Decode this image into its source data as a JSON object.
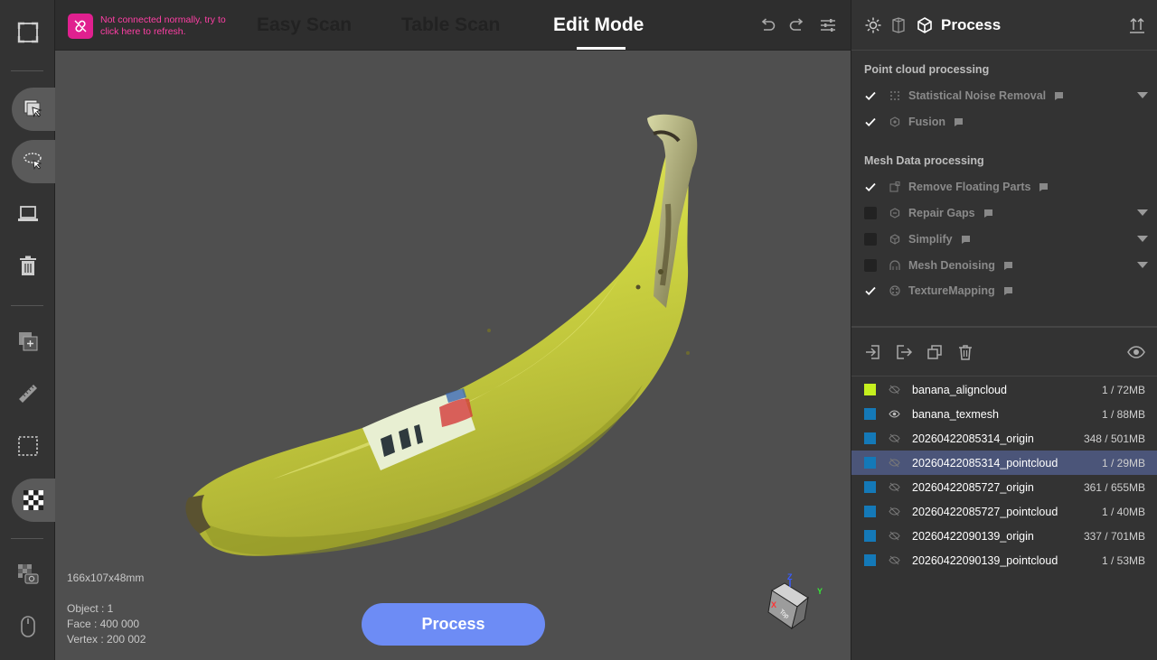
{
  "connection": {
    "message": "Not connected normally, try to click here to refresh.",
    "color": "#e0208f"
  },
  "modes": {
    "easy_scan": "Easy Scan",
    "table_scan": "Table Scan",
    "edit_mode": "Edit Mode",
    "active": "edit_mode"
  },
  "viewport": {
    "dimensions": "166x107x48mm",
    "object": "Object : 1",
    "face": "Face : 400 000",
    "vertex": "Vertex : 200 002",
    "process_button": "Process",
    "axes": {
      "z": "Z",
      "y": "Y",
      "x": "X",
      "top": "Top"
    }
  },
  "left_toolbar": {
    "items": [
      {
        "icon": "fit-view-icon"
      },
      {
        "icon": "select-cursor-icon",
        "active": true
      },
      {
        "icon": "lasso-select-icon",
        "active": true
      },
      {
        "icon": "laptop-icon"
      },
      {
        "icon": "trash-icon"
      },
      {
        "icon": "add-copy-icon"
      },
      {
        "icon": "ruler-icon"
      },
      {
        "icon": "crop-frame-icon"
      },
      {
        "icon": "checkerboard-icon",
        "active": true
      },
      {
        "icon": "texture-camera-icon"
      },
      {
        "icon": "mouse-icon"
      }
    ]
  },
  "process_panel": {
    "title": "Process",
    "sections": [
      {
        "title": "Point cloud processing",
        "items": [
          {
            "label": "Statistical Noise Removal",
            "checked": true,
            "dropdown": true
          },
          {
            "label": "Fusion",
            "checked": true,
            "dropdown": false
          }
        ]
      },
      {
        "title": "Mesh Data processing",
        "items": [
          {
            "label": "Remove Floating Parts",
            "checked": true,
            "dropdown": false
          },
          {
            "label": "Repair Gaps",
            "checked": false,
            "dropdown": true
          },
          {
            "label": "Simplify",
            "checked": false,
            "dropdown": true
          },
          {
            "label": "Mesh Denoising",
            "checked": false,
            "dropdown": true
          },
          {
            "label": "TextureMapping",
            "checked": true,
            "dropdown": false
          }
        ]
      }
    ]
  },
  "files": [
    {
      "name": "banana_aligncloud",
      "size": "1 / 72MB",
      "color": "#c6f01e",
      "visible": false,
      "selected": false
    },
    {
      "name": "banana_texmesh",
      "size": "1 / 88MB",
      "color": "#1479b8",
      "visible": true,
      "selected": false
    },
    {
      "name": "20260422085314_origin",
      "size": "348 / 501MB",
      "color": "#1479b8",
      "visible": false,
      "selected": false
    },
    {
      "name": "20260422085314_pointcloud",
      "size": "1 / 29MB",
      "color": "#1479b8",
      "visible": false,
      "selected": true
    },
    {
      "name": "20260422085727_origin",
      "size": "361 / 655MB",
      "color": "#1479b8",
      "visible": false,
      "selected": false
    },
    {
      "name": "20260422085727_pointcloud",
      "size": "1 / 40MB",
      "color": "#1479b8",
      "visible": false,
      "selected": false
    },
    {
      "name": "20260422090139_origin",
      "size": "337 / 701MB",
      "color": "#1479b8",
      "visible": false,
      "selected": false
    },
    {
      "name": "20260422090139_pointcloud",
      "size": "1 / 53MB",
      "color": "#1479b8",
      "visible": false,
      "selected": false
    }
  ]
}
